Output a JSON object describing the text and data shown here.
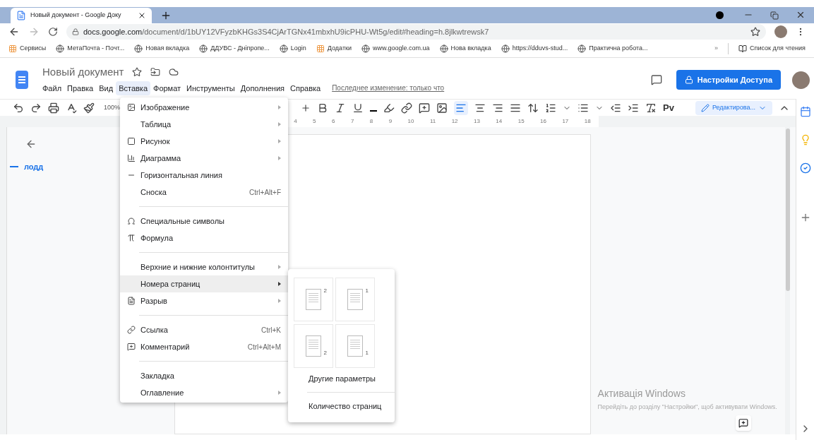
{
  "browser": {
    "tab": {
      "title": "Новый документ - Google Доку",
      "selected": true
    },
    "url": {
      "domain": "docs.google.com",
      "path": "/document/d/1bUY12VFyzbKHGs3S4CjArTGNx41mbxhU9icPHU-Wt5g/edit#heading=h.8jlkwtrewsk7"
    },
    "bookmarks": [
      {
        "label": "Сервисы"
      },
      {
        "label": "МетаПочта - Почт..."
      },
      {
        "label": "Новая вкладка"
      },
      {
        "label": "ДДУВС - Дніпропе..."
      },
      {
        "label": "Login"
      },
      {
        "label": "Додатки"
      },
      {
        "label": "www.google.com.ua"
      },
      {
        "label": "Нова вкладка"
      },
      {
        "label": "https://dduvs-stud..."
      },
      {
        "label": "Практична робота..."
      }
    ],
    "more_bookmarks": "»",
    "reading_list": "Список для чтения"
  },
  "doc": {
    "title": "Новый документ",
    "menus": [
      {
        "label": "Файл",
        "selected": false
      },
      {
        "label": "Правка",
        "selected": false
      },
      {
        "label": "Вид",
        "selected": false
      },
      {
        "label": "Вставка",
        "selected": true
      },
      {
        "label": "Формат",
        "selected": false
      },
      {
        "label": "Инструменты",
        "selected": false
      },
      {
        "label": "Дополнения",
        "selected": false
      },
      {
        "label": "Справка",
        "selected": false
      }
    ],
    "last_edit": "Последнее изменение: только что",
    "share_button": "Настройки Доступа",
    "zoom": "100%",
    "input_tools": "Pv",
    "editing_mode": "Редактирова...",
    "ruler": [
      "4",
      "5",
      "6",
      "7",
      "8",
      "9",
      "10",
      "11",
      "12",
      "13",
      "14",
      "15",
      "16",
      "17",
      "18"
    ],
    "outline": [
      {
        "text": "лодд"
      }
    ]
  },
  "insert_menu": [
    {
      "kind": "item",
      "label": "Изображение",
      "submenu": true,
      "selected": false
    },
    {
      "kind": "item",
      "label": "Таблица",
      "submenu": true,
      "selected": false
    },
    {
      "kind": "item",
      "label": "Рисунок",
      "submenu": true,
      "selected": false
    },
    {
      "kind": "item",
      "label": "Диаграмма",
      "submenu": true,
      "selected": false
    },
    {
      "kind": "item",
      "label": "Горизонтальная линия",
      "submenu": false,
      "selected": false
    },
    {
      "kind": "item",
      "label": "Сноска",
      "shortcut": "Ctrl+Alt+F",
      "submenu": false,
      "selected": false
    },
    {
      "kind": "separator"
    },
    {
      "kind": "item",
      "label": "Специальные символы",
      "submenu": false,
      "selected": false
    },
    {
      "kind": "item",
      "label": "Формула",
      "submenu": false,
      "selected": false
    },
    {
      "kind": "separator"
    },
    {
      "kind": "item",
      "label": "Верхние и нижние колонтитулы",
      "submenu": true,
      "selected": false
    },
    {
      "kind": "item",
      "label": "Номера страниц",
      "submenu": true,
      "selected": true
    },
    {
      "kind": "item",
      "label": "Разрыв",
      "submenu": true,
      "selected": false
    },
    {
      "kind": "separator"
    },
    {
      "kind": "item",
      "label": "Ссылка",
      "shortcut": "Ctrl+K",
      "submenu": false,
      "selected": false
    },
    {
      "kind": "item",
      "label": "Комментарий",
      "shortcut": "Ctrl+Alt+M",
      "submenu": false,
      "selected": false
    },
    {
      "kind": "separator"
    },
    {
      "kind": "item",
      "label": "Закладка",
      "submenu": false,
      "selected": false
    },
    {
      "kind": "item",
      "label": "Оглавление",
      "submenu": true,
      "selected": false
    }
  ],
  "page_numbers_menu": {
    "options": [
      {
        "label": "2"
      },
      {
        "label": "1"
      },
      {
        "label": "2"
      },
      {
        "label": "1"
      }
    ],
    "items": [
      "Другие параметры",
      "Количество страниц"
    ]
  },
  "activation_notice": {
    "title": "Активація Windows",
    "text": "Перейдіть до розділу \"Настройки\", щоб активувати Windows."
  }
}
